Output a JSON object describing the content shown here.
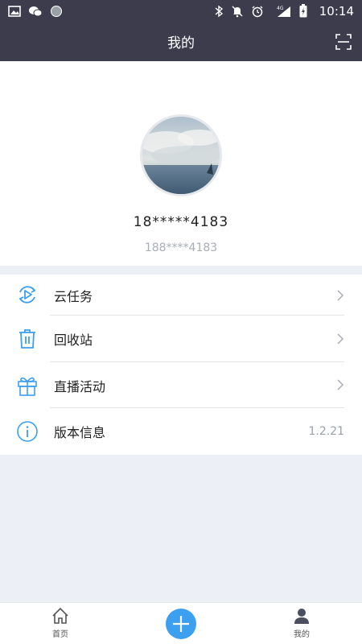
{
  "status_bar": {
    "time": "10:14",
    "network": "4G",
    "icons": [
      "image-icon",
      "wechat-icon",
      "circle-icon",
      "bluetooth-icon",
      "mute-icon",
      "alarm-icon",
      "signal-icon",
      "battery-charging-icon"
    ]
  },
  "header": {
    "title": "我的",
    "scan_icon": "scan-icon",
    "background": "#3d3c4c"
  },
  "profile": {
    "username": "18*****4183",
    "phone": "188****4183",
    "avatar_icon": "avatar-image"
  },
  "menu": {
    "items": [
      {
        "label": "云任务",
        "icon": "cloud-task-icon",
        "trailing": "chevron"
      },
      {
        "label": "回收站",
        "icon": "trash-icon",
        "trailing": "chevron"
      },
      {
        "label": "直播活动",
        "icon": "gift-icon",
        "trailing": "chevron"
      },
      {
        "label": "版本信息",
        "icon": "info-icon",
        "value": "1.2.21"
      }
    ]
  },
  "bottom_nav": {
    "home_label": "首页",
    "mine_label": "我的",
    "add_icon": "plus-icon",
    "accent": "#3d9ff0"
  }
}
